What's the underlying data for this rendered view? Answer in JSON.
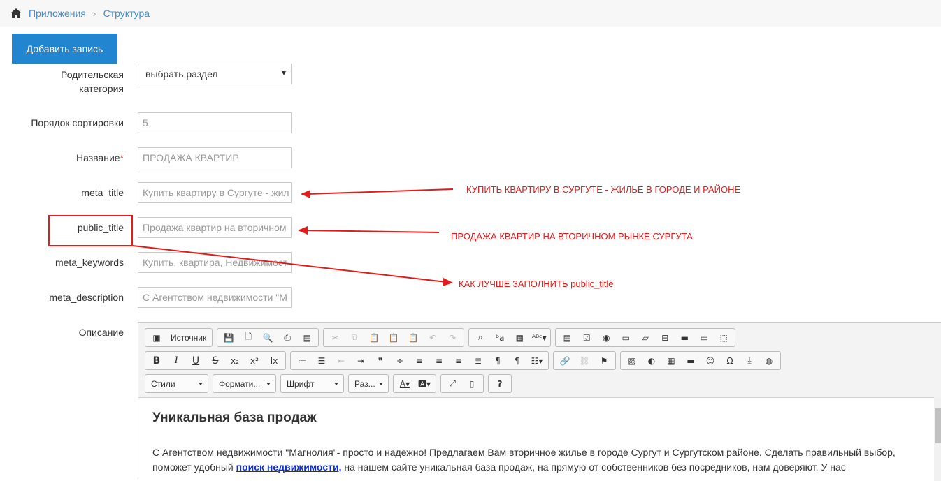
{
  "breadcrumb": {
    "home_icon": "home-icon",
    "items": [
      "Приложения",
      "Структура"
    ]
  },
  "add_button": "Добавить запись",
  "form": {
    "parent_label_1": "Родительская",
    "parent_label_2": "категория",
    "parent_value": "выбрать раздел",
    "sort_label": "Порядок сортировки",
    "sort_value": "5",
    "name_label": "Название",
    "name_required": "*",
    "name_value": "ПРОДАЖА КВАРТИР",
    "meta_title_label": "meta_title",
    "meta_title_value": "Купить квартиру в Сургуте - жил",
    "public_title_label": "public_title",
    "public_title_value": "Продажа квартир на вторичном",
    "meta_keywords_label": "meta_keywords",
    "meta_keywords_value": "Купить, квартира, Недвижимост",
    "meta_description_label": "meta_description",
    "meta_description_value": "С Агентством недвижимости \"М",
    "description_label": "Описание"
  },
  "annotations": {
    "meta_title": "КУПИТЬ КВАРТИРУ В СУРГУТЕ - ЖИЛЬЕ В ГОРОДЕ И РАЙОНЕ",
    "public_title": "ПРОДАЖА КВАРТИР НА ВТОРИЧНОМ РЫНКЕ СУРГУТА",
    "question": "КАК ЛУЧШЕ ЗАПОЛНИТЬ public_title",
    "color": "#e31b1b"
  },
  "editor": {
    "source_label": "Источник",
    "styles_combo": "Стили",
    "format_combo": "Формати...",
    "font_combo": "Шрифт",
    "size_combo": "Раз...",
    "heading": "Уникальная база продаж",
    "para_1": "С Агентством недвижимости \"Магнолия\"- просто и надежно! Предлагаем Вам вторичное жилье в городе Сургут и Сургутском районе. Сделать правильный выбор, поможет удобный ",
    "para_link": "поиск недвижимости,",
    "para_2": " на нашем сайте уникальная база продаж, на прямую от собственников без посредников, нам доверяют. У нас"
  },
  "colors": {
    "primary": "#2185d0",
    "link": "#428bca",
    "annotation": "#e31b1b"
  }
}
